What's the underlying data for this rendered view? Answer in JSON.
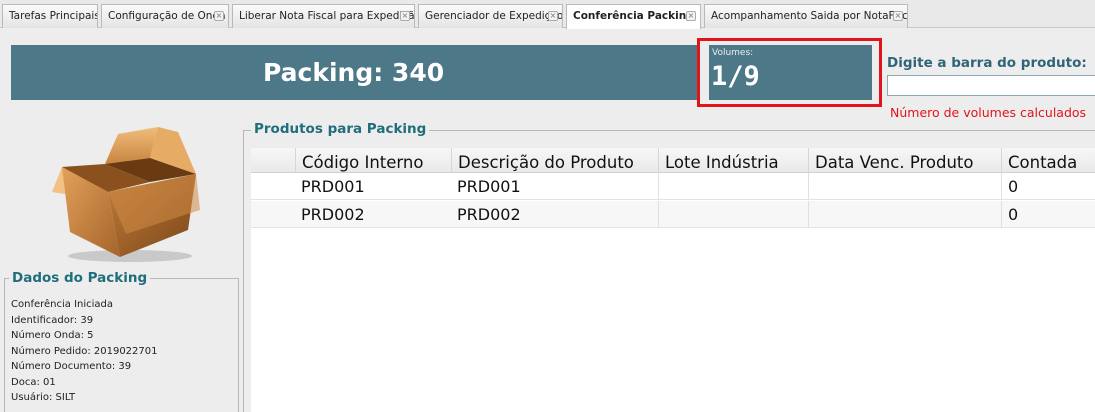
{
  "tabs": [
    {
      "label": "Tarefas Principais",
      "closable": false,
      "active": false
    },
    {
      "label": "Configuração de Onda",
      "closable": true,
      "active": false
    },
    {
      "label": "Liberar Nota Fiscal para Expedição",
      "closable": true,
      "active": false
    },
    {
      "label": "Gerenciador de Expedição",
      "closable": true,
      "active": false
    },
    {
      "label": "Conferência Packing",
      "closable": true,
      "active": true
    },
    {
      "label": "Acompanhamento Saida por NotaFiscal",
      "closable": true,
      "active": false
    }
  ],
  "header": {
    "title": "Packing: 340",
    "volumes_label": "Volumes:",
    "volumes_value": "1/9"
  },
  "barcode": {
    "label": "Digite a barra do produto:",
    "value": "",
    "note": "Número de volumes calculados"
  },
  "dados": {
    "legend": "Dados do Packing",
    "lines": [
      "Conferência Iniciada",
      "Identificador: 39",
      "Número Onda: 5",
      "Número Pedido: 2019022701",
      "Número Documento: 39",
      "Doca: 01",
      "Usuário: SILT"
    ]
  },
  "produtos": {
    "legend": "Produtos para Packing",
    "columns": [
      "Código Interno",
      "Descrição do Produto",
      "Lote Indústria",
      "Data Venc. Produto",
      "Contada"
    ],
    "rows": [
      [
        "PRD001",
        "PRD001",
        "",
        "",
        "0"
      ],
      [
        "PRD002",
        "PRD002",
        "",
        "",
        "0"
      ]
    ]
  },
  "colors": {
    "header_bg": "#4d7888",
    "highlight_border": "#e0141a",
    "legend_text": "#1f6e7c",
    "note_text": "#e0141a"
  },
  "icons": {
    "tab_close": "close-icon",
    "box": "cardboard-box-icon"
  }
}
